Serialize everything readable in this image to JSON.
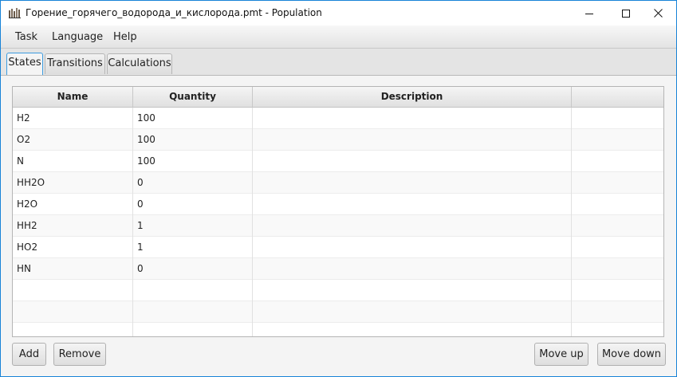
{
  "window": {
    "title": "Горение_горячего_водорода_и_кислорода.pmt - Population",
    "app_icon": "bar-chart-icon",
    "controls": {
      "minimize_icon": "minimize-icon",
      "maximize_icon": "maximize-icon",
      "close_icon": "close-icon"
    }
  },
  "menu": {
    "items": [
      {
        "label": "Task"
      },
      {
        "label": "Language"
      },
      {
        "label": "Help"
      }
    ]
  },
  "tabs": [
    {
      "label": "States",
      "active": true
    },
    {
      "label": "Transitions",
      "active": false
    },
    {
      "label": "Calculations",
      "active": false
    }
  ],
  "table": {
    "columns": [
      "Name",
      "Quantity",
      "Description",
      ""
    ],
    "rows": [
      {
        "name": "H2",
        "quantity": "100",
        "description": ""
      },
      {
        "name": "O2",
        "quantity": "100",
        "description": ""
      },
      {
        "name": "N",
        "quantity": "100",
        "description": ""
      },
      {
        "name": "HH2O",
        "quantity": "0",
        "description": ""
      },
      {
        "name": "H2O",
        "quantity": "0",
        "description": ""
      },
      {
        "name": "HH2",
        "quantity": "1",
        "description": ""
      },
      {
        "name": "HO2",
        "quantity": "1",
        "description": ""
      },
      {
        "name": "HN",
        "quantity": "0",
        "description": ""
      }
    ]
  },
  "buttons": {
    "add": "Add",
    "remove": "Remove",
    "move_up": "Move up",
    "move_down": "Move down"
  },
  "colors": {
    "window_border": "#1883d7",
    "active_tab_border": "#3c9ce0"
  }
}
